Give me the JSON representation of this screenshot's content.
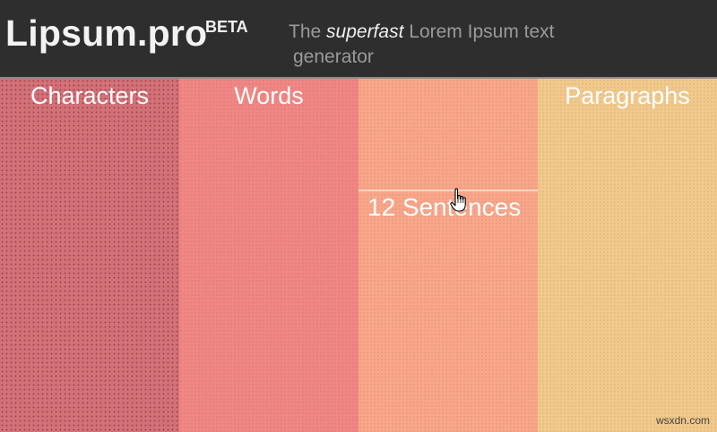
{
  "header": {
    "logo": "Lipsum.pro",
    "badge": "BETA",
    "tagline": {
      "prefix": "The",
      "emphasis": "superfast",
      "rest_line1": "Lorem Ipsum text",
      "line2": "generator"
    }
  },
  "columns": [
    {
      "label": "Characters",
      "color": "#d47077"
    },
    {
      "label": "Words",
      "color": "#f08784"
    },
    {
      "label": "",
      "color": "#f9a68a",
      "value": "12 Sentences"
    },
    {
      "label": "Paragraphs",
      "color": "#f2c98c"
    }
  ],
  "cursor": {
    "icon": "hand-pointer-icon"
  },
  "watermark": "wsxdn.com"
}
